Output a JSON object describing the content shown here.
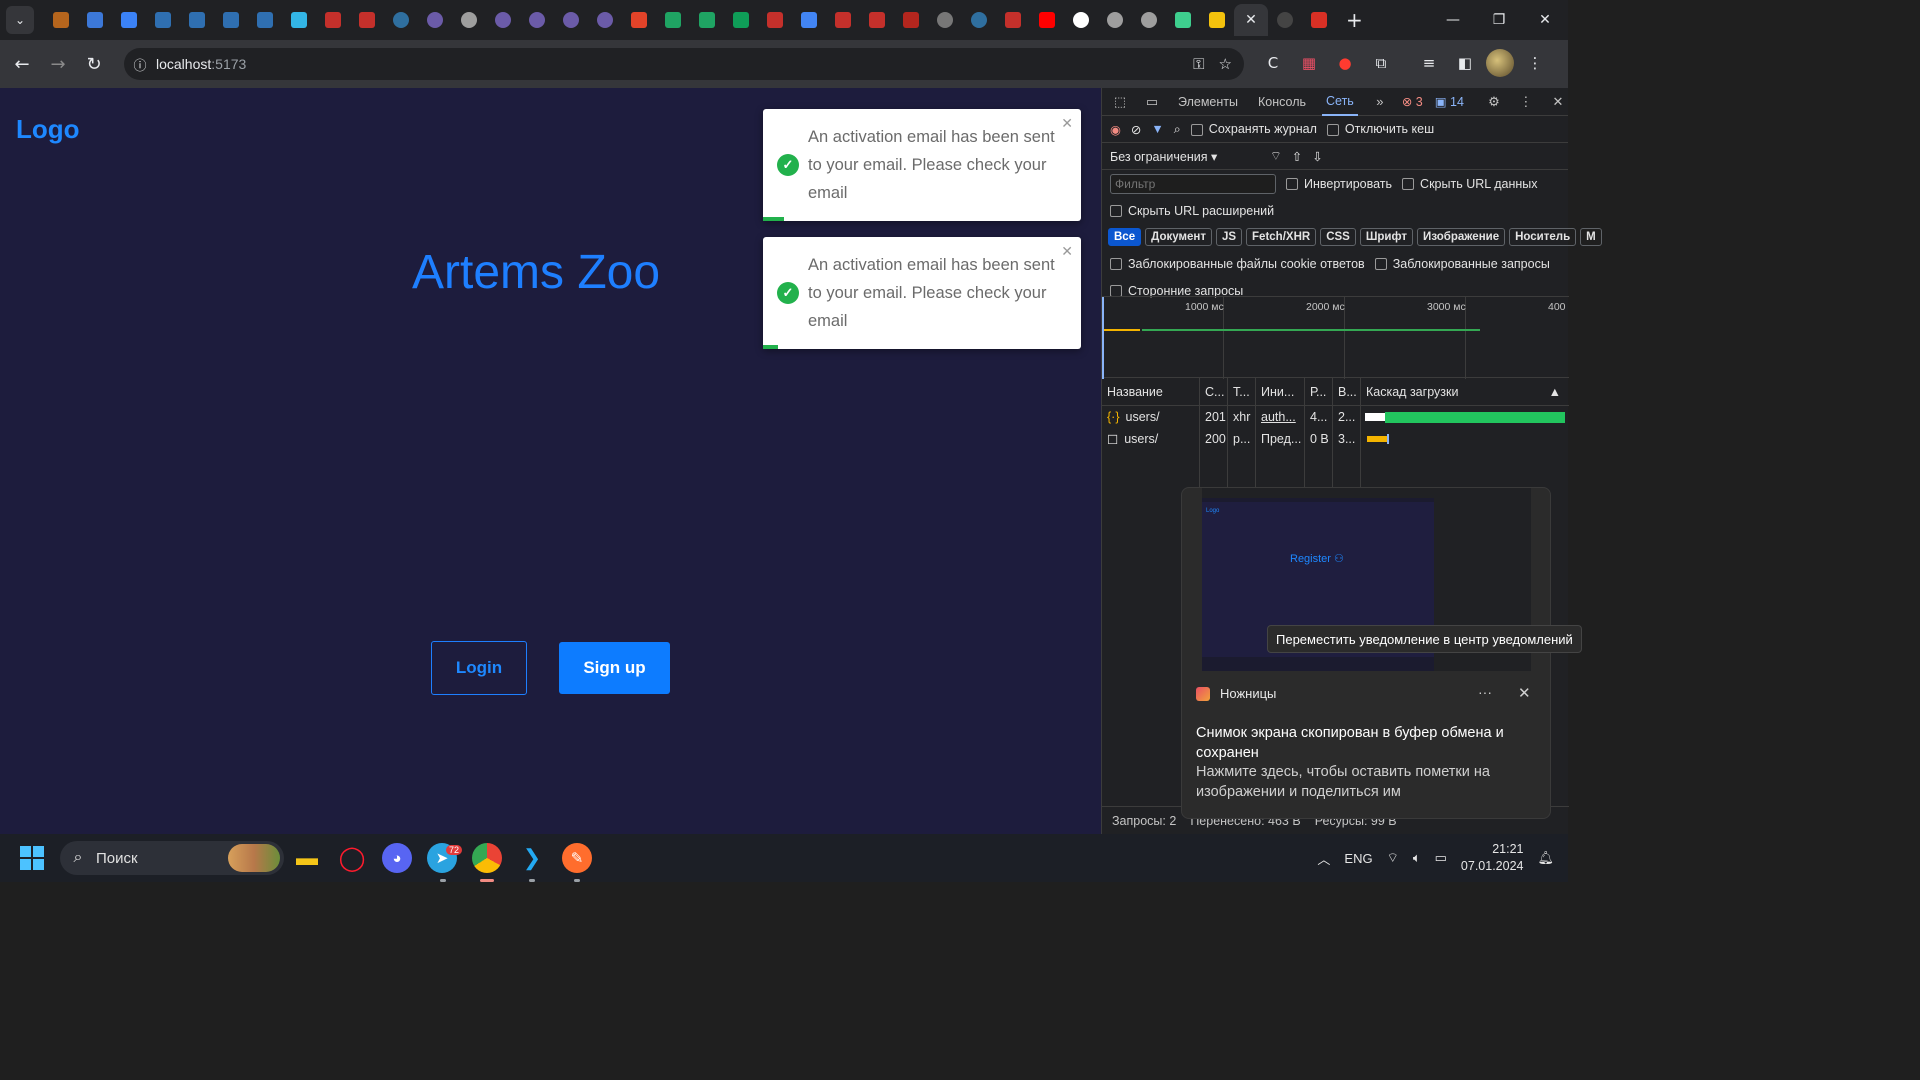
{
  "browser": {
    "address": {
      "host": "localhost",
      "port": ":5173"
    },
    "tab_close": "✕",
    "new_tab": "+"
  },
  "page": {
    "logo": "Logo",
    "title": "Artems Zoo",
    "login_label": "Login",
    "signup_label": "Sign up",
    "toasts": [
      {
        "message": "An activation email has been sent to your email. Please check your email"
      },
      {
        "message": "An activation email has been sent to your email. Please check your email"
      }
    ],
    "accent_color": "#1e7fff",
    "background_color": "#1d1c3d",
    "success_color": "#22b14c"
  },
  "devtools": {
    "tabs": [
      "Элементы",
      "Консоль",
      "Сеть"
    ],
    "active_tab": "Сеть",
    "error_count": "3",
    "message_count": "14",
    "preserve_log": "Сохранять журнал",
    "disable_cache": "Отключить кеш",
    "throttling": "Без ограничения",
    "filter_placeholder": "Фильтр",
    "invert": "Инвертировать",
    "hide_data_urls": "Скрыть URL данных",
    "hide_extension_urls": "Скрыть URL расширений",
    "type_filters": [
      "Все",
      "Документ",
      "JS",
      "Fetch/XHR",
      "CSS",
      "Шрифт",
      "Изображение",
      "Носитель",
      "М"
    ],
    "blocked_cookies": "Заблокированные файлы cookie ответов",
    "blocked_requests": "Заблокированные запросы",
    "third_party": "Сторонние запросы",
    "timeline_labels": [
      "1000 мс",
      "2000 мс",
      "3000 мс",
      "400"
    ],
    "columns": [
      "Название",
      "С...",
      "Т...",
      "Ини...",
      "Р...",
      "В...",
      "Каскад загрузки"
    ],
    "rows": [
      {
        "name": "users/",
        "status": "201",
        "type": "xhr",
        "initiator": "auth...",
        "size": "4...",
        "time": "2..."
      },
      {
        "name": "users/",
        "status": "200",
        "type": "p...",
        "initiator": "Пред...",
        "size": "0 B",
        "time": "3..."
      }
    ],
    "status_bar": [
      "Запросы: 2",
      "Перенесено: 463 B",
      "Ресурсы: 99 B"
    ]
  },
  "notification": {
    "tooltip": "Переместить уведомление в центр уведомлений",
    "app_name": "Ножницы",
    "more": "···",
    "close": "✕",
    "title": "Снимок экрана скопирован в буфер обмена и сохранен",
    "body": "Нажмите здесь, чтобы оставить пометки на изображении и поделиться им",
    "thumb_logo": "Logo",
    "thumb_register": "Register ⚇"
  },
  "taskbar": {
    "search_label": "Поиск",
    "telegram_badge": "72",
    "language": "ENG",
    "time": "21:21",
    "date": "07.01.2024"
  }
}
